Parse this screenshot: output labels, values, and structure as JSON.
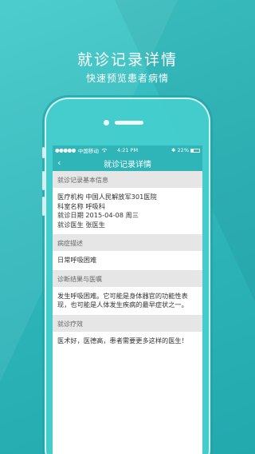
{
  "promo": {
    "headline": "就诊记录详情",
    "subline": "快速预览患者病情"
  },
  "status_bar": {
    "carrier": "中国移动",
    "signal": "●●●●●",
    "wifi_icon": "wifi-icon",
    "time": "4:21 PM",
    "bluetooth": "✱",
    "battery": "22%"
  },
  "nav": {
    "back_icon": "‹",
    "title": "就诊记录详情"
  },
  "sections": {
    "basic": {
      "header": "就诊记录基本信息",
      "institution": "医疗机构 中国人民解放军301医院",
      "department": "科室名称 呼吸科",
      "date": "就诊日期 2015-04-08 周三",
      "doctor": "就诊医生 张医生"
    },
    "symptom": {
      "header": "病症描述",
      "text": "日常呼吸困难"
    },
    "diagnosis": {
      "header": "诊断结果与医嘱",
      "text": "发生呼吸困难。它可能是身体器官的功能性表现，也可能是人体发生疾病的最早症状之一。"
    },
    "effect": {
      "header": "就诊疗效",
      "text": "医术好，医德高，患者需要更多这样的医生！"
    }
  },
  "colors": {
    "background": "#2fb7bb",
    "bar": "#2fb4b8",
    "section_header_bg": "#e6e6e6"
  }
}
